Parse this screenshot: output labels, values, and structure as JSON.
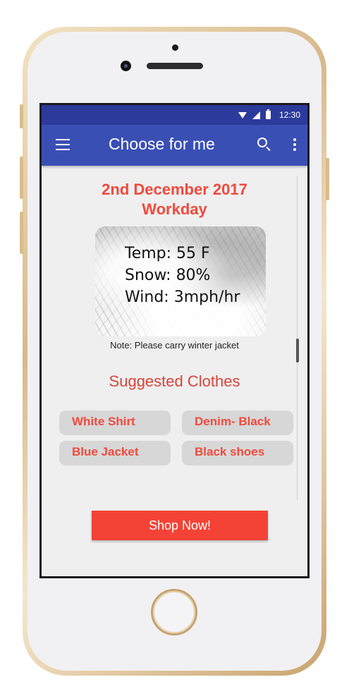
{
  "status_bar": {
    "time": "12:30"
  },
  "app_bar": {
    "title": "Choose for me"
  },
  "forecast": {
    "date": "2nd December 2017",
    "day_type": "Workday",
    "temp": "Temp: 55 F",
    "snow": "Snow: 80%",
    "wind": "Wind: 3mph/hr",
    "note": "Note: Please carry winter jacket"
  },
  "suggestions": {
    "title": "Suggested Clothes",
    "items": [
      "White Shirt",
      "Denim- Black",
      "Blue Jacket",
      "Black shoes"
    ]
  },
  "shop_button": {
    "label": "Shop Now!"
  },
  "colors": {
    "primary": "#3a4fb4",
    "status_bar": "#2c3a9b",
    "accent": "#f44336",
    "heading": "#f04a3c"
  }
}
